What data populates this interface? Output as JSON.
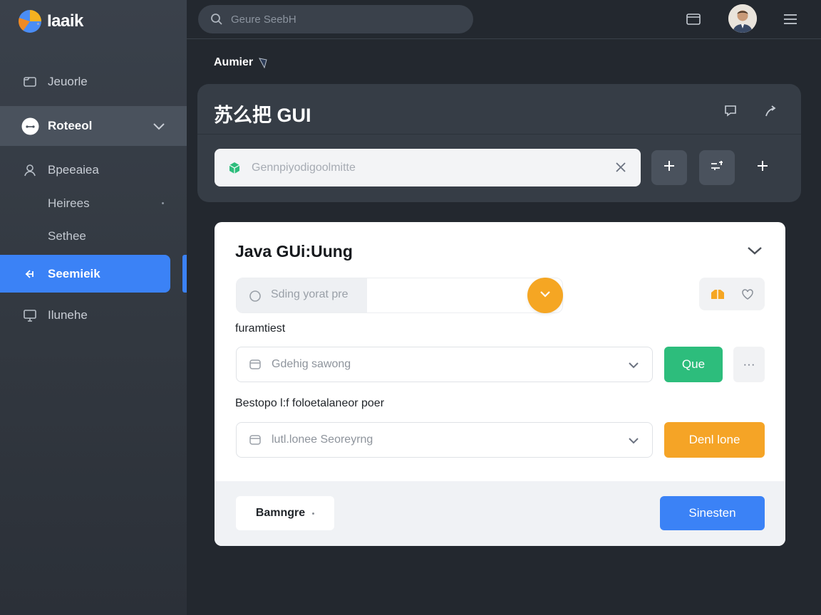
{
  "app": {
    "name": "Iaaik"
  },
  "sidebar": {
    "items": [
      {
        "label": "Jeuorle",
        "icon": "folder-icon"
      },
      {
        "label": "Roteeol",
        "icon": "chat-bubble-icon",
        "expanded": true
      },
      {
        "label": "Bpeeaiea",
        "icon": "user-icon"
      },
      {
        "label": "Heirees",
        "sub": true
      },
      {
        "label": "Sethee",
        "sub": true
      },
      {
        "label": "Seemieik",
        "icon": "key-icon",
        "active": true
      },
      {
        "label": "Ilunehe",
        "icon": "monitor-icon"
      }
    ]
  },
  "topbar": {
    "search_placeholder": "Geure SeebH",
    "icons": [
      "mail-icon",
      "user-avatar",
      "menu-icon"
    ]
  },
  "breadcrumb": {
    "label": "Aumier"
  },
  "panel": {
    "title": "苏么把 GUI",
    "field_placeholder": "Gennpiyodigoolmitte",
    "icons": [
      "comment-icon",
      "share-icon",
      "plus-icon",
      "filter-icon",
      "plus-icon"
    ]
  },
  "card": {
    "title": "Java GUi:Uung",
    "search_placeholder": "Sding yorat pre",
    "label_1": "furamtiest",
    "select_1_value": "Gdehig sawong",
    "button_green": "Que",
    "button_more": "···",
    "label_2": "Bestopo l:f foloetalaneor poer",
    "select_2_value": "lutl.lonee Seoreyrng",
    "button_orange": "Denl lone",
    "footer": {
      "secondary_button": "Bamngre",
      "primary_button": "Sinesten"
    }
  },
  "colors": {
    "sidebar_active": "#3b82f6",
    "accent_green": "#2dbd7c",
    "accent_orange": "#f5a426",
    "primary_blue": "#3b82f6",
    "background": "#23282f"
  }
}
